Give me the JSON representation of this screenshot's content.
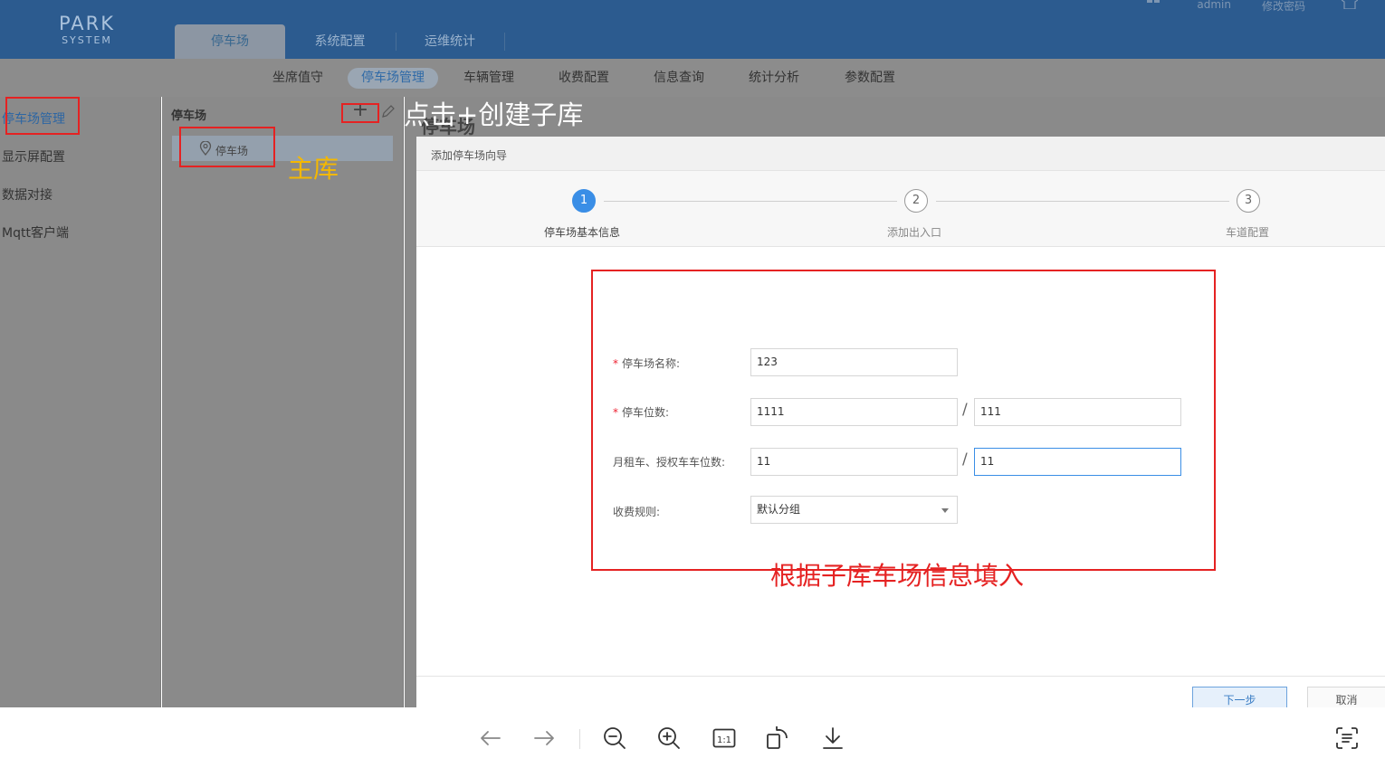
{
  "app": {
    "logo_line1": "PARK",
    "logo_line2": "SYSTEM",
    "top_tabs": [
      "停车场",
      "系统配置",
      "运维统计"
    ],
    "top_right": {
      "user": "admin",
      "change_password": "修改密码"
    }
  },
  "subnav": {
    "items": [
      "坐席值守",
      "停车场管理",
      "车辆管理",
      "收费配置",
      "信息查询",
      "统计分析",
      "参数配置"
    ],
    "active_index": 1
  },
  "sidebar": {
    "items": [
      "停车场管理",
      "显示屏配置",
      "数据对接",
      "Mqtt客户端"
    ],
    "active_index": 0
  },
  "tree": {
    "title": "停车场",
    "node_label": "停车场"
  },
  "page": {
    "background_title": "停车场"
  },
  "modal": {
    "title": "添加停车场向导",
    "steps": [
      {
        "number": "1",
        "label": "停车场基本信息"
      },
      {
        "number": "2",
        "label": "添加出入口"
      },
      {
        "number": "3",
        "label": "车道配置"
      }
    ],
    "current_step": 1,
    "form": {
      "name_label": "停车场名称:",
      "name_value": "123",
      "spaces_label": "停车位数:",
      "spaces_total": "1111",
      "spaces_available": "111",
      "monthly_label": "月租车、授权车车位数:",
      "monthly_total": "11",
      "monthly_available": "11",
      "fee_rule_label": "收费规则:",
      "fee_rule_value": "默认分组",
      "required_mark": "*",
      "separator": "/"
    },
    "next_label": "下一步",
    "cancel_label": "取消"
  },
  "annotations": {
    "click_hint": "点击+创建子库",
    "main_lib": "主库",
    "fill_hint": "根据子库车场信息填入",
    "hint_color": "#ffffff",
    "main_lib_color": "#f5b800",
    "fill_hint_color": "#e52222"
  },
  "colors": {
    "header": "#2c5b8f",
    "accent": "#3a8ee6",
    "annotation_red": "#e52222"
  },
  "viewer_toolbar": {
    "icons": [
      "arrow-left-icon",
      "arrow-right-icon",
      "zoom-out-icon",
      "zoom-in-icon",
      "actual-size-icon",
      "rotate-icon",
      "download-icon",
      "ocr-icon"
    ],
    "actual_size_text": "1:1"
  }
}
